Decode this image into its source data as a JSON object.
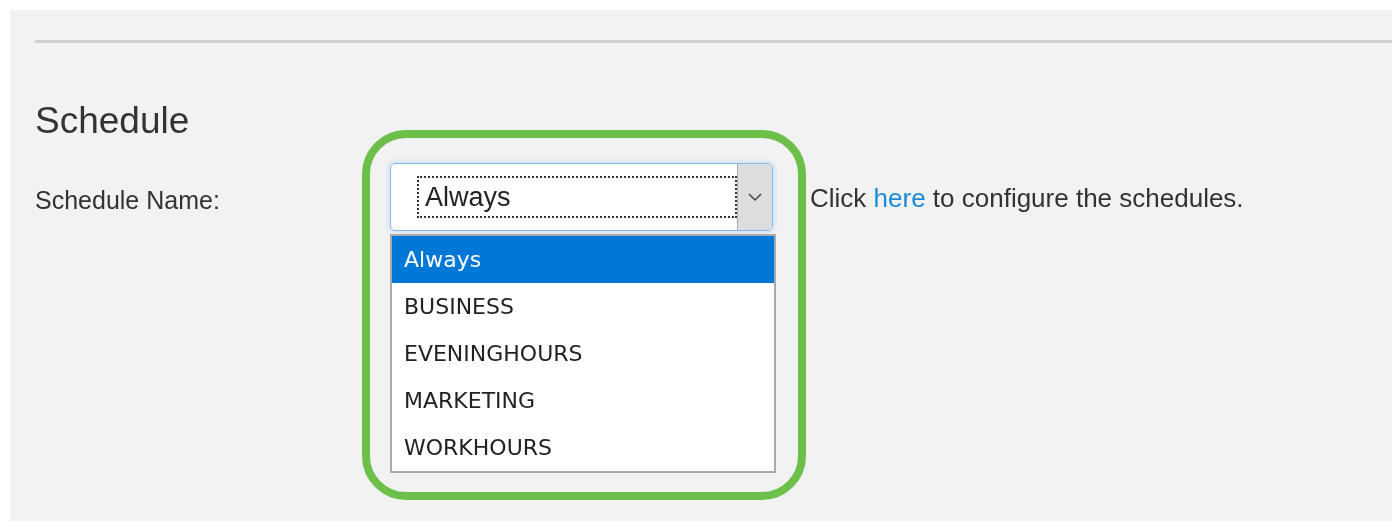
{
  "section": {
    "title": "Schedule"
  },
  "schedule_name": {
    "label": "Schedule Name:",
    "value": "Always",
    "expanded": true,
    "options": [
      {
        "label": "Always",
        "selected": true
      },
      {
        "label": "BUSINESS",
        "selected": false
      },
      {
        "label": "EVENINGHOURS",
        "selected": false
      },
      {
        "label": "MARKETING",
        "selected": false
      },
      {
        "label": "WORKHOURS",
        "selected": false
      }
    ]
  },
  "hint": {
    "before": "Click ",
    "link": "here",
    "after": " to configure the schedules."
  }
}
